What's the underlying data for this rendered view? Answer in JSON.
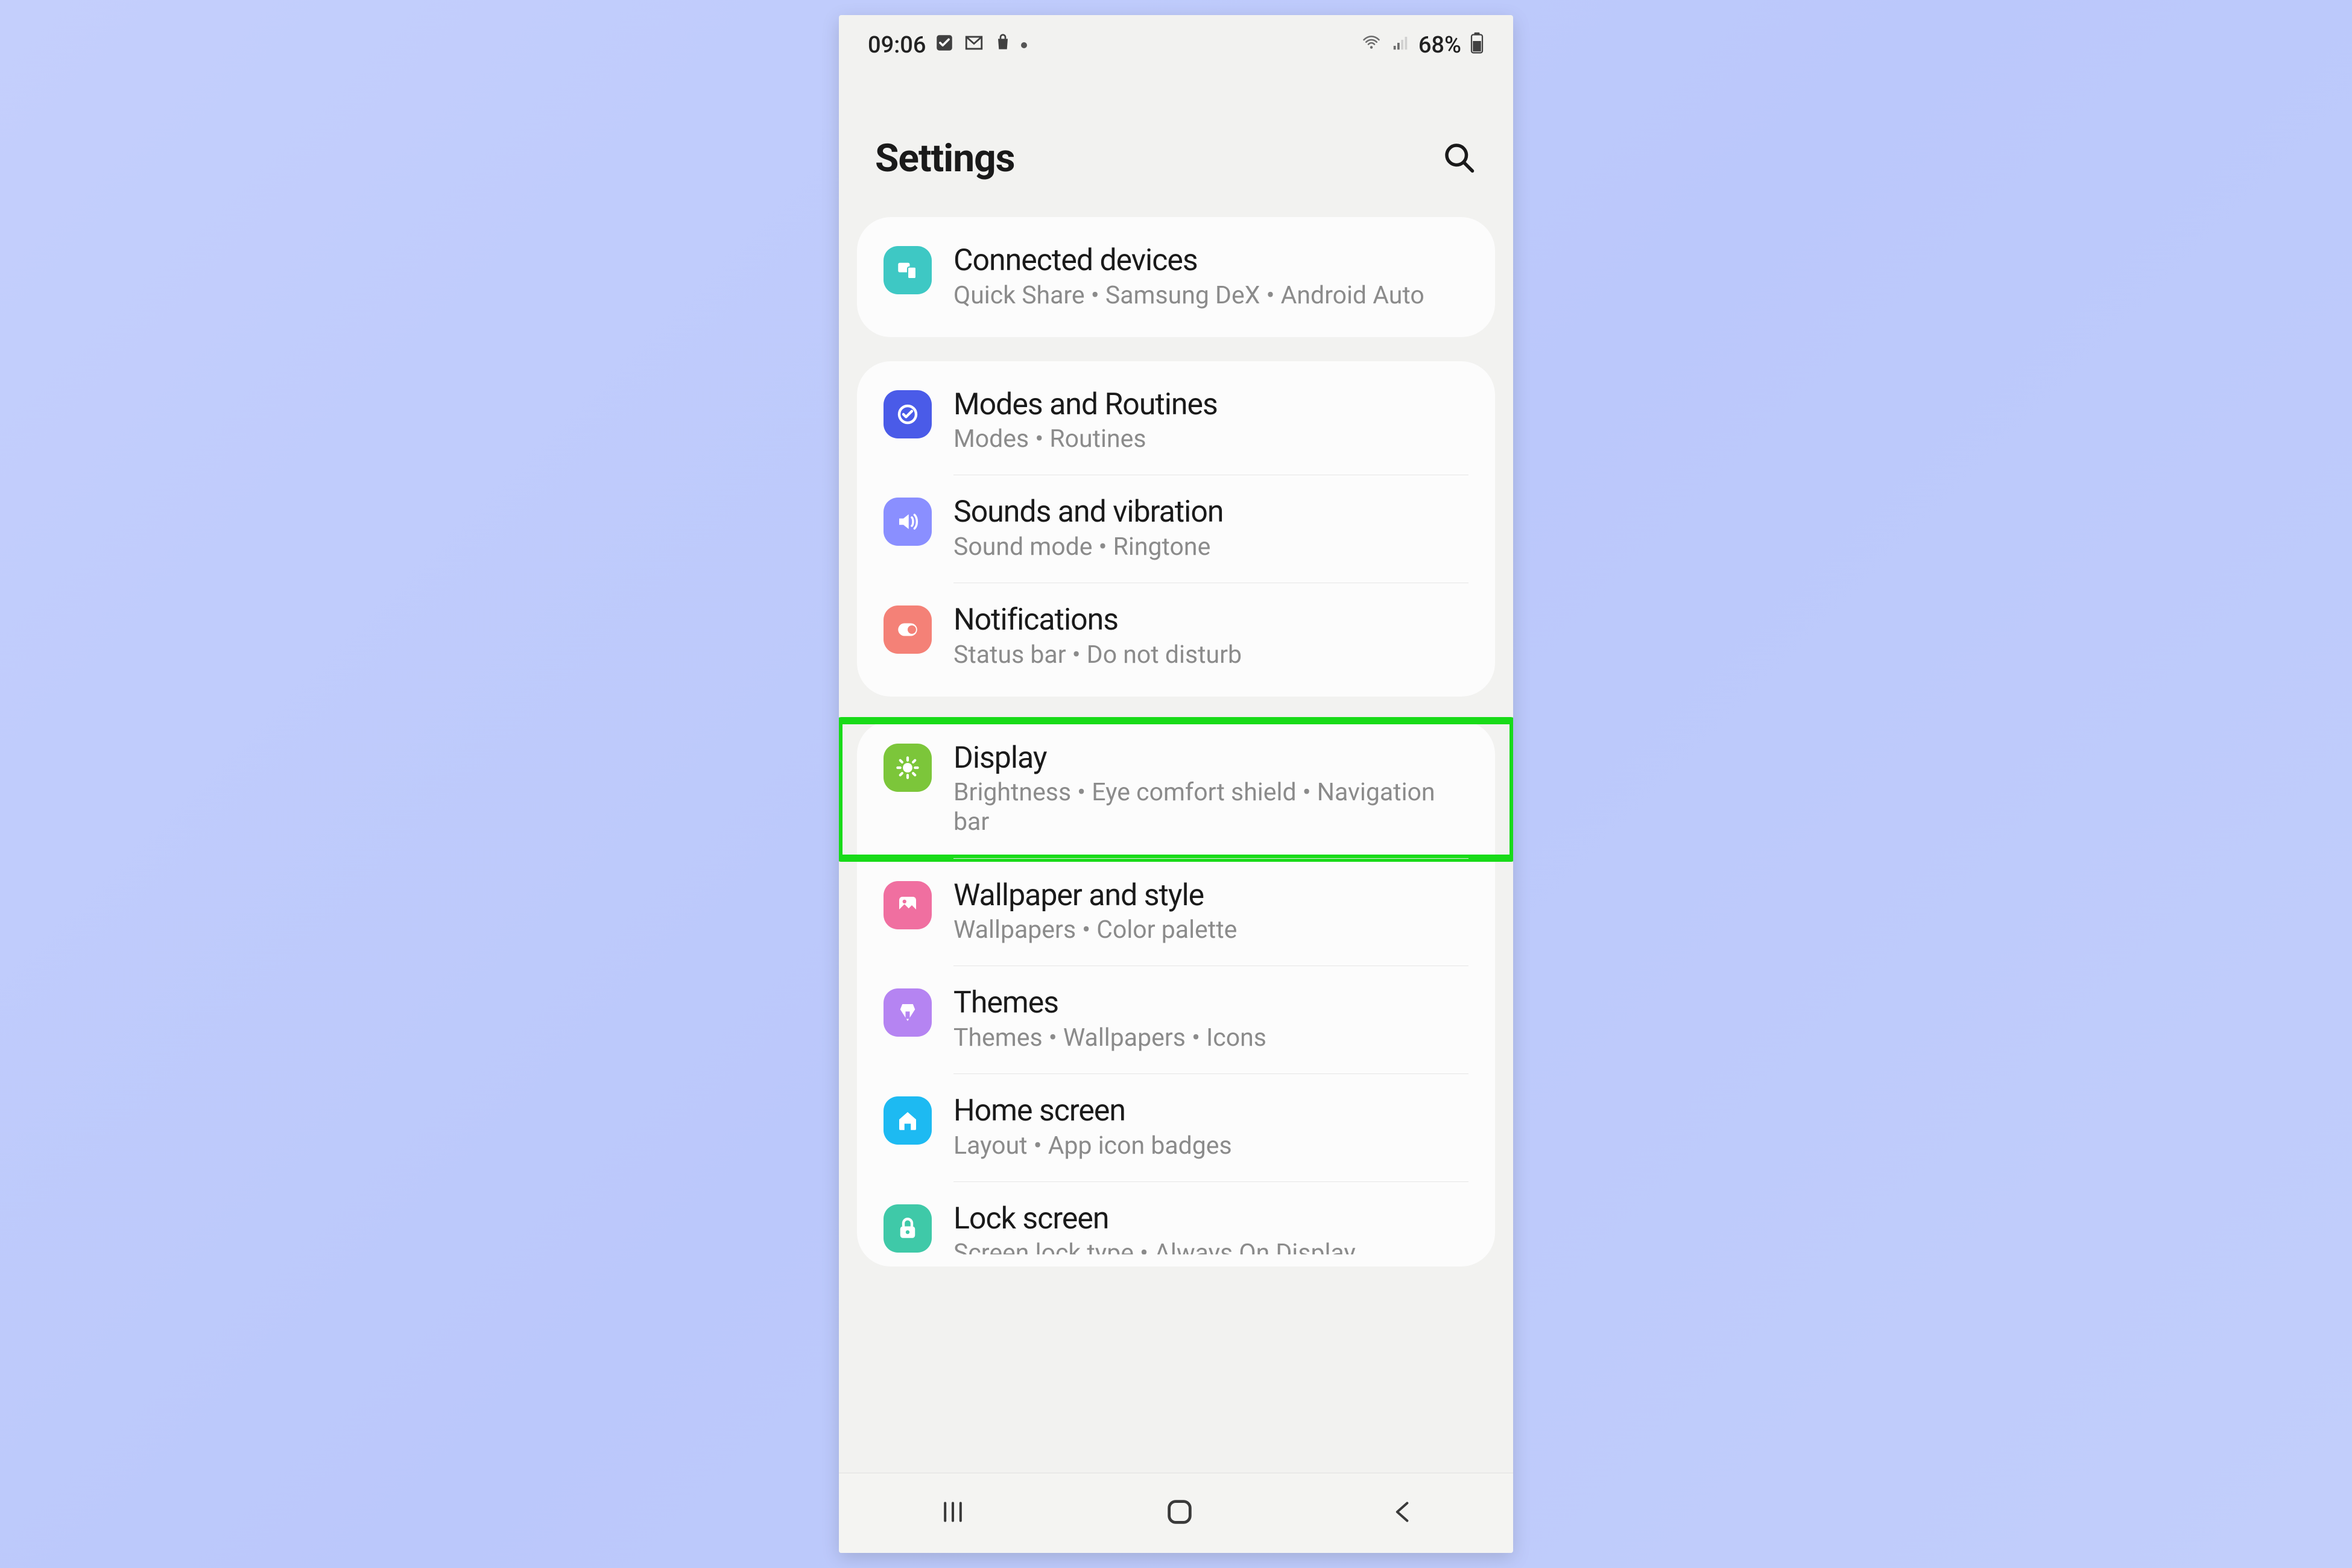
{
  "status": {
    "time": "09:06",
    "icons_left": [
      "checkbox",
      "mail",
      "shopping",
      "dot"
    ],
    "battery_pct": "68%"
  },
  "header": {
    "title": "Settings"
  },
  "groups": [
    {
      "id": "g1",
      "rows": [
        {
          "id": "connected",
          "title": "Connected devices",
          "sub": "Quick Share  •  Samsung DeX  •  Android Auto",
          "color": "#3ec8c4"
        }
      ]
    },
    {
      "id": "g2",
      "rows": [
        {
          "id": "modes",
          "title": "Modes and Routines",
          "sub": "Modes  •  Routines",
          "color": "#4a5be8"
        },
        {
          "id": "sounds",
          "title": "Sounds and vibration",
          "sub": "Sound mode  •  Ringtone",
          "color": "#8a8fff"
        },
        {
          "id": "notifications",
          "title": "Notifications",
          "sub": "Status bar  •  Do not disturb",
          "color": "#f48177"
        }
      ]
    },
    {
      "id": "g3",
      "rows": [
        {
          "id": "display",
          "title": "Display",
          "sub": "Brightness  •  Eye comfort shield  •  Navigation bar",
          "color": "#7cc63a",
          "highlight": true
        },
        {
          "id": "wallpaper",
          "title": "Wallpaper and style",
          "sub": "Wallpapers  •  Color palette",
          "color": "#f06fa0"
        },
        {
          "id": "themes",
          "title": "Themes",
          "sub": "Themes  •  Wallpapers  •  Icons",
          "color": "#b584f2"
        },
        {
          "id": "home",
          "title": "Home screen",
          "sub": "Layout  •  App icon badges",
          "color": "#1dbaf2"
        },
        {
          "id": "lock",
          "title": "Lock screen",
          "sub": "Screen lock type  •  Always On Display",
          "color": "#3fc9a8"
        }
      ]
    }
  ]
}
